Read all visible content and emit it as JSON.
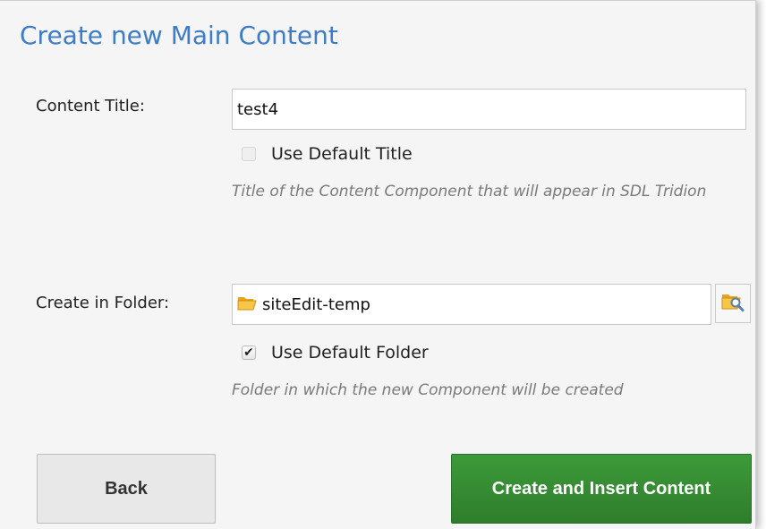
{
  "dialog": {
    "title": "Create new Main Content"
  },
  "content_title": {
    "label": "Content Title:",
    "value": "test4",
    "use_default": {
      "label": "Use Default Title",
      "checked": false,
      "disabled": true
    },
    "hint": "Title of the Content Component that will appear in SDL Tridion"
  },
  "folder": {
    "label": "Create in Folder:",
    "value": "siteEdit-temp",
    "icon": "folder-icon",
    "browse_icon": "folder-search-icon",
    "use_default": {
      "label": "Use Default Folder",
      "checked": true
    },
    "hint": "Folder in which the new Component will be created"
  },
  "buttons": {
    "back": "Back",
    "create": "Create and Insert Content"
  },
  "colors": {
    "title": "#3d7cc7",
    "primary_button": "#369234",
    "background": "#f5f5f5"
  }
}
